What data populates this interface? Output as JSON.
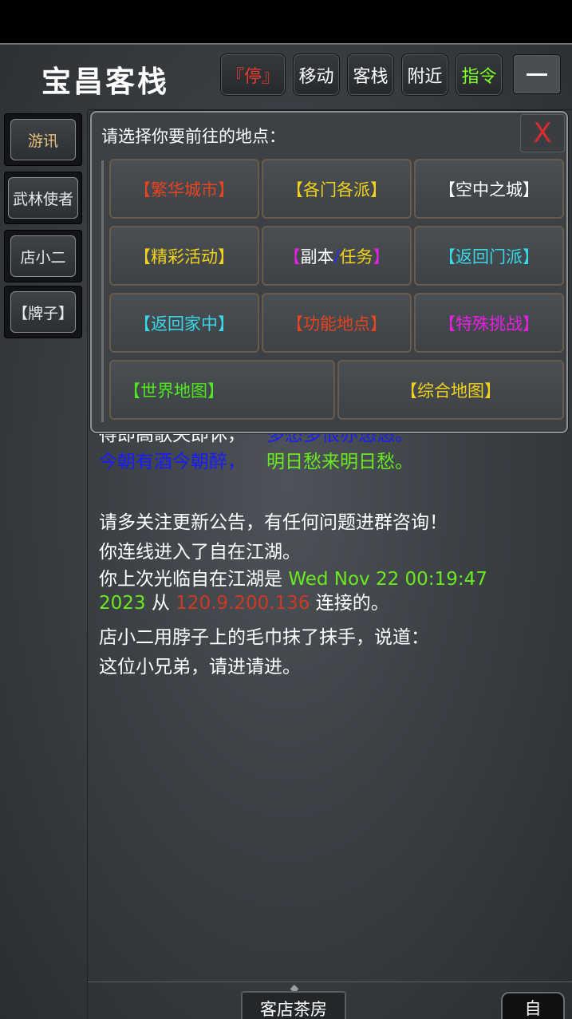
{
  "header": {
    "title": "宝昌客栈",
    "buttons": [
      {
        "label": "『停』"
      },
      {
        "label": "移动"
      },
      {
        "label": "客栈"
      },
      {
        "label": "附近"
      },
      {
        "label": "指令"
      }
    ]
  },
  "sidebar": {
    "items": [
      {
        "label": "游讯"
      },
      {
        "label": "武林使者"
      },
      {
        "label": "店小二"
      },
      {
        "label": "【牌子】"
      }
    ]
  },
  "modal": {
    "title": "请选择你要前往的地点：",
    "close_label": "X",
    "options": [
      {
        "label": "【繁华城市】",
        "color": "#e8421f"
      },
      {
        "label": "【各门各派】",
        "color": "#f2d21a"
      },
      {
        "label": "【空中之城】",
        "color": "#ffffff"
      },
      {
        "label": "【精彩活动】",
        "color": "#f2d21a"
      },
      {
        "label_open": "【",
        "label_a": "副本",
        "label_sep": "/",
        "label_b": "任务",
        "label_close": "】"
      },
      {
        "label": "【返回门派】",
        "color": "#38d8e8"
      },
      {
        "label": "【返回家中】",
        "color": "#38d8e8"
      },
      {
        "label": "【功能地点】",
        "color": "#e8421f"
      },
      {
        "label": "【特殊挑战】",
        "color": "#e81ee0"
      },
      {
        "label": "【世界地图】",
        "color": "#4de81e"
      },
      {
        "label": "【综合地图】",
        "color": "#f2d21a"
      }
    ]
  },
  "log": {
    "partial_line_left": "得即高歌失即休，",
    "partial_line_right": "多愁多恨亦悠悠。",
    "poem_left": "今朝有酒今朝醉，",
    "poem_right": "明日愁来明日愁。",
    "notice": "请多关注更新公告，有任何问题进群咨询！",
    "connected": "你连线进入了自在江湖。",
    "last_visit_prefix": "你上次光临自在江湖是 ",
    "last_visit_time_a": "Wed Nov 22 00:19:47",
    "last_visit_time_b": "2023",
    "last_visit_from": " 从 ",
    "last_visit_ip": "120.9.200.136",
    "last_visit_suffix": " 连接的。",
    "waiter_line1": "店小二用脖子上的毛巾抹了抹手，说道：",
    "waiter_line2": "这位小兄弟，请进请进。"
  },
  "footer": {
    "room_label": "客店茶房",
    "auto_label": "自"
  }
}
